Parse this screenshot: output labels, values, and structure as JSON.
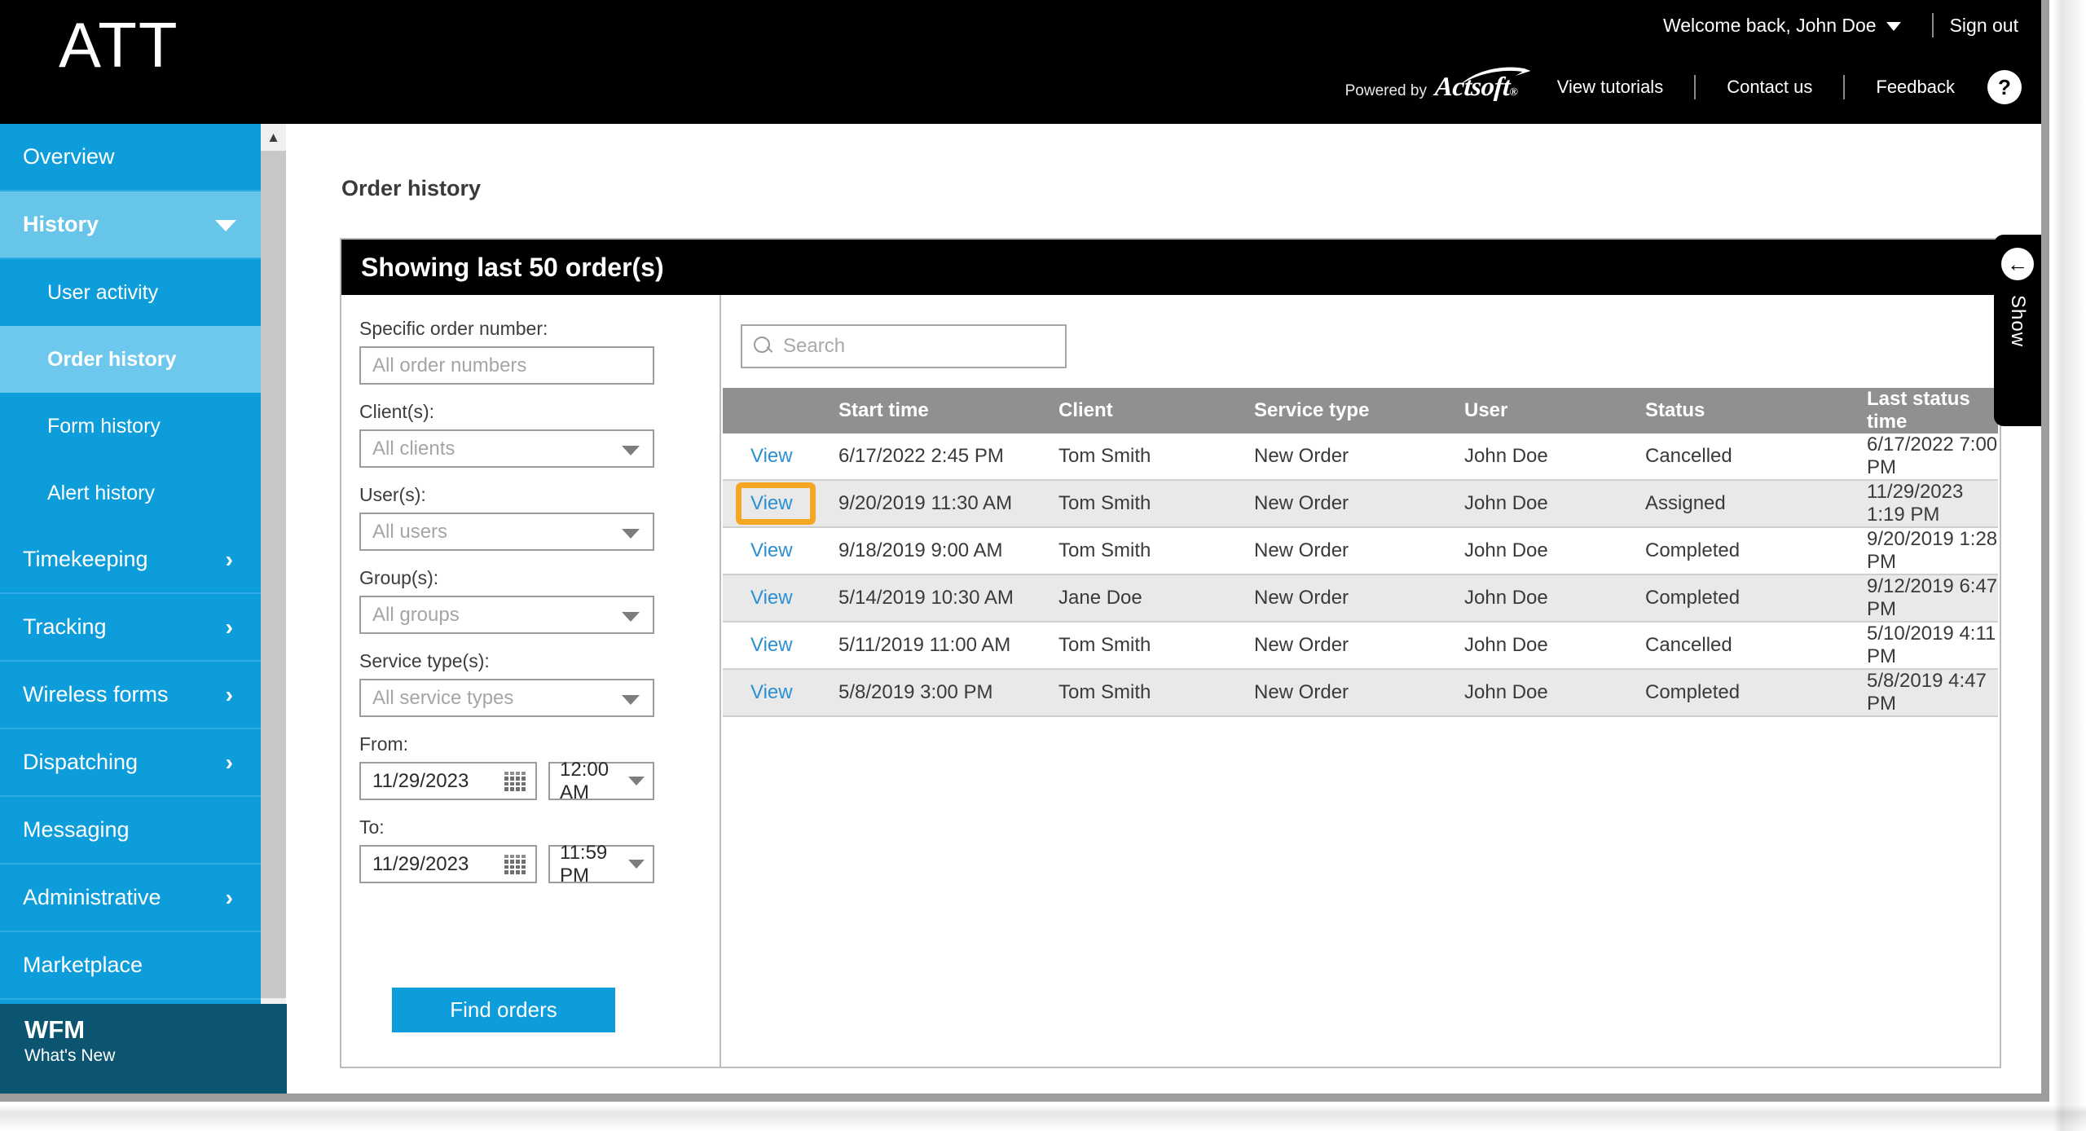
{
  "header": {
    "brand": "ATT",
    "welcome": "Welcome back, John Doe",
    "sign_out": "Sign out",
    "powered_by": "Powered by",
    "powered_brand": "Actsoft",
    "links": [
      "View tutorials",
      "Contact us",
      "Feedback"
    ],
    "help_glyph": "?",
    "accent_color": "#0d9ddb"
  },
  "sidebar": {
    "items": [
      {
        "label": "Overview",
        "type": "item",
        "state": "normal"
      },
      {
        "label": "History",
        "type": "item",
        "state": "expanded",
        "icon": "chevron-down-icon"
      },
      {
        "label": "User activity",
        "type": "sub",
        "state": "normal"
      },
      {
        "label": "Order history",
        "type": "sub",
        "state": "active"
      },
      {
        "label": "Form history",
        "type": "sub",
        "state": "normal"
      },
      {
        "label": "Alert history",
        "type": "sub",
        "state": "normal"
      },
      {
        "label": "Timekeeping",
        "type": "item",
        "state": "normal",
        "icon": "chevron-right-icon"
      },
      {
        "label": "Tracking",
        "type": "item",
        "state": "normal",
        "icon": "chevron-right-icon"
      },
      {
        "label": "Wireless forms",
        "type": "item",
        "state": "normal",
        "icon": "chevron-right-icon"
      },
      {
        "label": "Dispatching",
        "type": "item",
        "state": "normal",
        "icon": "chevron-right-icon"
      },
      {
        "label": "Messaging",
        "type": "item",
        "state": "normal"
      },
      {
        "label": "Administrative",
        "type": "item",
        "state": "normal",
        "icon": "chevron-right-icon"
      },
      {
        "label": "Marketplace",
        "type": "item",
        "state": "normal"
      }
    ],
    "banner": {
      "title": "WFM",
      "subtitle": "What's New"
    }
  },
  "main": {
    "page_title": "Order history",
    "panel_header": "Showing last 50 order(s)"
  },
  "filters": {
    "order_number": {
      "label": "Specific order number:",
      "placeholder": "All order numbers",
      "value": ""
    },
    "clients": {
      "label": "Client(s):",
      "placeholder": "All clients",
      "value": ""
    },
    "users": {
      "label": "User(s):",
      "placeholder": "All users",
      "value": ""
    },
    "groups": {
      "label": "Group(s):",
      "placeholder": "All groups",
      "value": ""
    },
    "service_types": {
      "label": "Service type(s):",
      "placeholder": "All service types",
      "value": ""
    },
    "from": {
      "label": "From:",
      "date": "11/29/2023",
      "time": "12:00 AM"
    },
    "to": {
      "label": "To:",
      "date": "11/29/2023",
      "time": "11:59 PM"
    },
    "find_button": "Find orders"
  },
  "search": {
    "placeholder": "Search",
    "value": ""
  },
  "table": {
    "columns": [
      "",
      "Start time",
      "Client",
      "Service type",
      "User",
      "Status",
      "Last status time"
    ],
    "view_label": "View",
    "rows": [
      {
        "start_time": "6/17/2022 2:45 PM",
        "client": "Tom Smith",
        "service_type": "New Order",
        "user": "John Doe",
        "status": "Cancelled",
        "last_status_time": "6/17/2022 7:00 PM",
        "highlighted": false
      },
      {
        "start_time": "9/20/2019 11:30 AM",
        "client": "Tom Smith",
        "service_type": "New Order",
        "user": "John Doe",
        "status": "Assigned",
        "last_status_time": "11/29/2023 1:19 PM",
        "highlighted": true
      },
      {
        "start_time": "9/18/2019 9:00 AM",
        "client": "Tom Smith",
        "service_type": "New Order",
        "user": "John Doe",
        "status": "Completed",
        "last_status_time": "9/20/2019 1:28 PM",
        "highlighted": false
      },
      {
        "start_time": "5/14/2019 10:30 AM",
        "client": "Jane Doe",
        "service_type": "New Order",
        "user": "John Doe",
        "status": "Completed",
        "last_status_time": "9/12/2019 6:47 PM",
        "highlighted": false
      },
      {
        "start_time": "5/11/2019 11:00 AM",
        "client": "Tom Smith",
        "service_type": "New Order",
        "user": "John Doe",
        "status": "Cancelled",
        "last_status_time": "5/10/2019 4:11 PM",
        "highlighted": false
      },
      {
        "start_time": "5/8/2019 3:00 PM",
        "client": "Tom Smith",
        "service_type": "New Order",
        "user": "John Doe",
        "status": "Completed",
        "last_status_time": "5/8/2019 4:47 PM",
        "highlighted": false
      }
    ],
    "highlight_color": "#f5a623"
  },
  "show_tab": {
    "label": "Show",
    "icon": "arrow-left-circle-icon",
    "glyph": "←"
  }
}
